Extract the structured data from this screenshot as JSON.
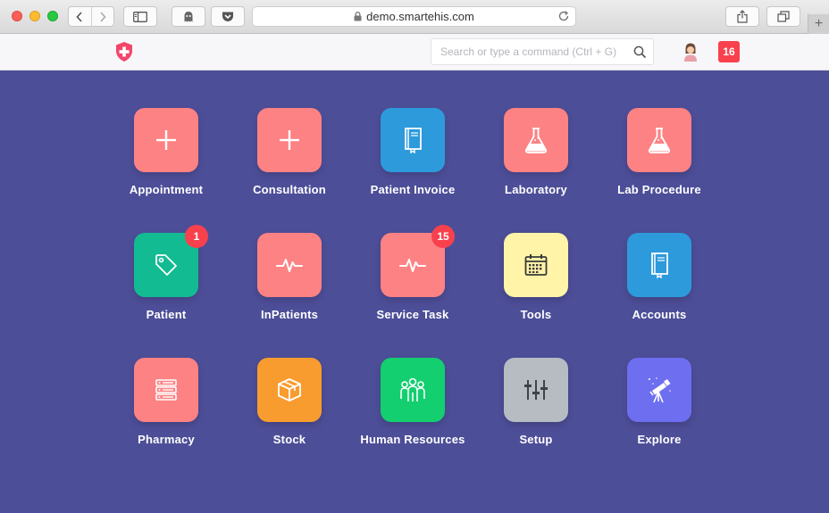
{
  "browser": {
    "url": "demo.smartehis.com"
  },
  "header": {
    "search_placeholder": "Search or type a command (Ctrl + G)",
    "notification_count": "16"
  },
  "tiles": [
    {
      "label": "Appointment",
      "color": "#fd8284",
      "icon": "plus-icon",
      "badge": ""
    },
    {
      "label": "Consultation",
      "color": "#fd8284",
      "icon": "plus-icon",
      "badge": ""
    },
    {
      "label": "Patient Invoice",
      "color": "#2d9adb",
      "icon": "book-icon",
      "badge": ""
    },
    {
      "label": "Laboratory",
      "color": "#fd8284",
      "icon": "flask-icon",
      "badge": ""
    },
    {
      "label": "Lab Procedure",
      "color": "#fd8284",
      "icon": "flask-icon",
      "badge": ""
    },
    {
      "label": "Patient",
      "color": "#12bb92",
      "icon": "tag-icon",
      "badge": "1"
    },
    {
      "label": "InPatients",
      "color": "#fd8284",
      "icon": "pulse-icon",
      "badge": ""
    },
    {
      "label": "Service Task",
      "color": "#fd8284",
      "icon": "pulse-icon",
      "badge": "15"
    },
    {
      "label": "Tools",
      "color": "#fff4a8",
      "icon": "calendar-icon",
      "badge": ""
    },
    {
      "label": "Accounts",
      "color": "#2d9adb",
      "icon": "book-icon",
      "badge": ""
    },
    {
      "label": "Pharmacy",
      "color": "#fd8284",
      "icon": "server-icon",
      "badge": ""
    },
    {
      "label": "Stock",
      "color": "#f89c2f",
      "icon": "box-icon",
      "badge": ""
    },
    {
      "label": "Human Resources",
      "color": "#13cf6f",
      "icon": "people-icon",
      "badge": ""
    },
    {
      "label": "Setup",
      "color": "#b7bcc3",
      "icon": "sliders-icon",
      "badge": ""
    },
    {
      "label": "Explore",
      "color": "#6d6ef0",
      "icon": "telescope-icon",
      "badge": ""
    }
  ]
}
